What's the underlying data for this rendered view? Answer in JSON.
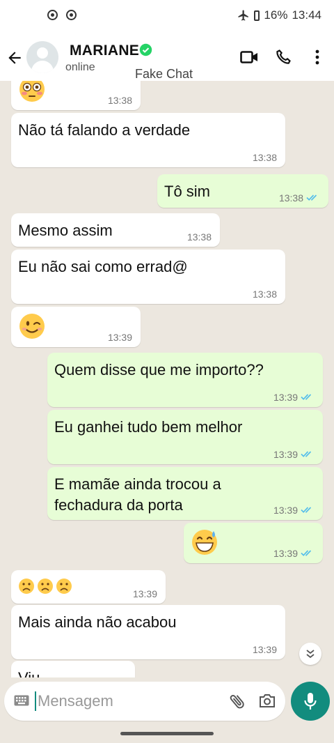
{
  "status_bar": {
    "battery": "16%",
    "time": "13:44"
  },
  "header": {
    "name": "MARIANE",
    "status": "online",
    "watermark": "Fake Chat"
  },
  "messages": [
    {
      "dir": "in",
      "emoji": "flushed",
      "time": "13:38"
    },
    {
      "dir": "in",
      "text": "Não tá falando a verdade",
      "time": "13:38"
    },
    {
      "dir": "out",
      "text": "Tô sim",
      "time": "13:38",
      "read": true
    },
    {
      "dir": "in",
      "text": "Mesmo assim",
      "time": "13:38"
    },
    {
      "dir": "in",
      "text": "Eu não sai como errad@",
      "time": "13:38"
    },
    {
      "dir": "in",
      "emoji": "wink",
      "time": "13:39"
    },
    {
      "dir": "out",
      "text": "Quem disse que me importo??",
      "time": "13:39",
      "read": true
    },
    {
      "dir": "out",
      "text": "Eu ganhei tudo bem melhor",
      "time": "13:39",
      "read": true
    },
    {
      "dir": "out",
      "text": "E mamãe ainda trocou a\nfechadura da porta",
      "time": "13:39",
      "read": true
    },
    {
      "dir": "out",
      "emoji": "grin-sweat",
      "time": "13:39",
      "read": true
    },
    {
      "dir": "in",
      "emoji": "frown x3",
      "time": "13:39"
    },
    {
      "dir": "in",
      "text": "Mais ainda não acabou",
      "time": "13:39"
    },
    {
      "dir": "in",
      "text": "Viu",
      "time": ""
    }
  ],
  "composer": {
    "placeholder": "Mensagem"
  },
  "colors": {
    "accent": "#128c7e",
    "out_bubble": "#e7fdd6",
    "read_ticks": "#53bdeb",
    "verified": "#25d366"
  }
}
